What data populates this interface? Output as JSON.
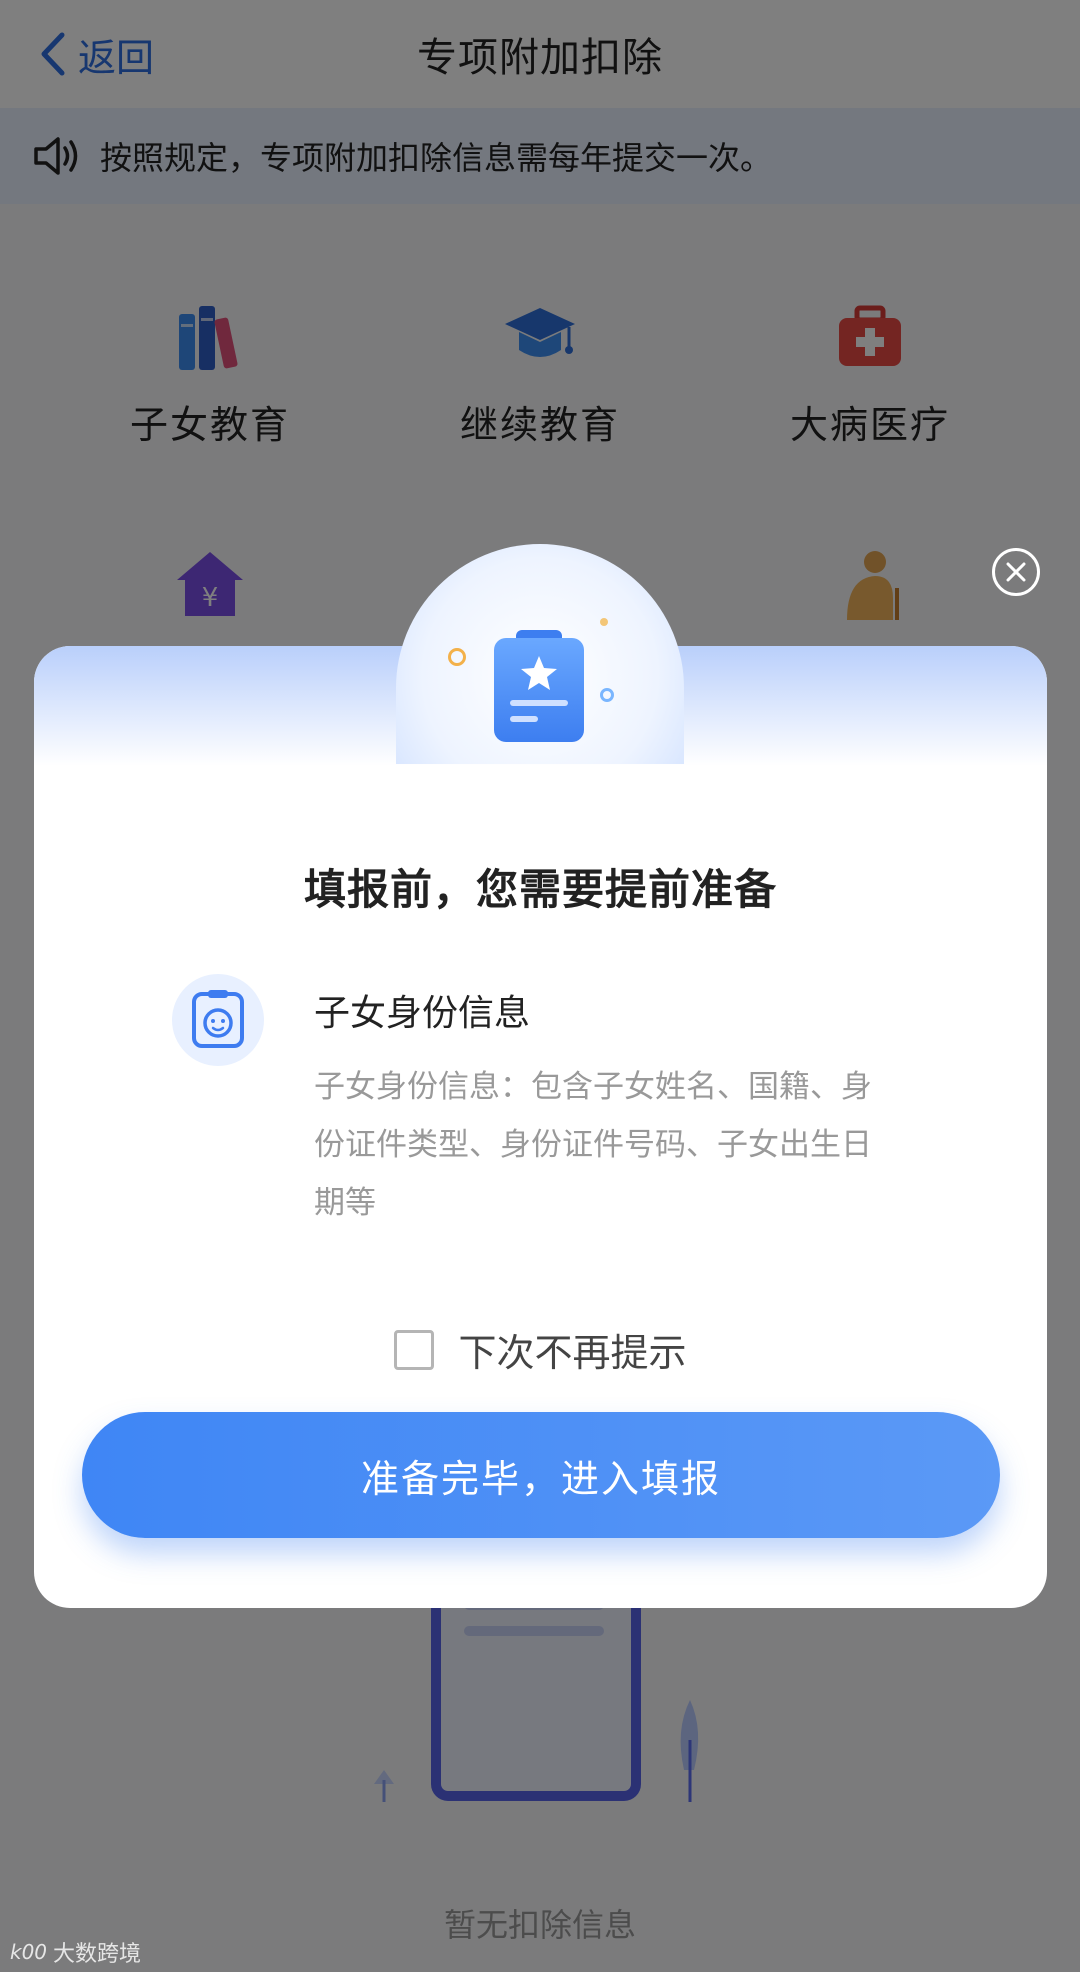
{
  "nav": {
    "back_label": "返回",
    "title": "专项附加扣除"
  },
  "notice": {
    "text": "按照规定，专项附加扣除信息需每年提交一次。",
    "icon": "speaker-icon"
  },
  "categories": [
    {
      "label": "子女教育",
      "icon": "books-icon"
    },
    {
      "label": "继续教育",
      "icon": "graduation-cap-icon"
    },
    {
      "label": "大病医疗",
      "icon": "medical-kit-icon"
    },
    {
      "label": "",
      "icon": "house-yuan-icon"
    },
    {
      "label": "",
      "icon": "elderly-icon"
    }
  ],
  "empty_state": {
    "text": "暂无扣除信息"
  },
  "modal": {
    "title": "填报前，您需要提前准备",
    "item": {
      "title": "子女身份信息",
      "desc": "子女身份信息：包含子女姓名、国籍、身份证件类型、身份证件号码、子女出生日期等"
    },
    "checkbox_label": "下次不再提示",
    "checkbox_checked": false,
    "confirm_label": "准备完毕，进入填报"
  },
  "watermark": {
    "logo": "k00",
    "text": "大数跨境"
  },
  "colors": {
    "accent": "#3f86f5",
    "notice_bg": "#e8f0ff",
    "overlay": "rgba(0,0,0,0.5)"
  }
}
